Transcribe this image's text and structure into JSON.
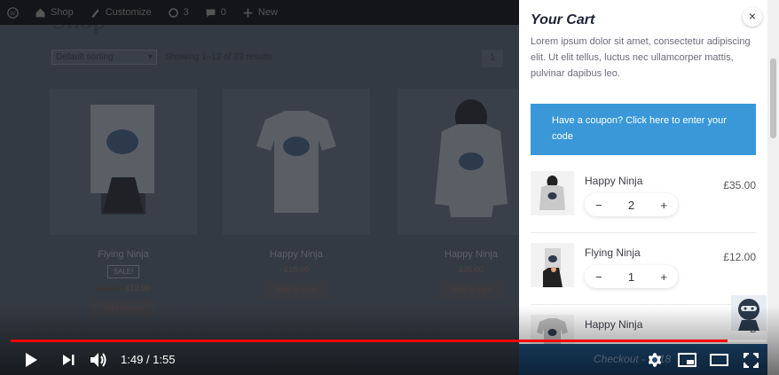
{
  "admin_bar": {
    "items": [
      "Shop",
      "Customize",
      "3",
      "0",
      "New"
    ]
  },
  "shop": {
    "title": "Shop",
    "sort_value": "Default sorting",
    "result_count": "Showing 1–12 of 23 results",
    "page_control": "1",
    "products": [
      {
        "name": "Flying Ninja",
        "badge": "SALE!",
        "old_price": "£15.00",
        "price": "£12.00",
        "button": "Add to cart"
      },
      {
        "name": "Happy Ninja",
        "price": "£18.00",
        "button": "Add to cart"
      },
      {
        "name": "Happy Ninja",
        "price": "£35.00",
        "button": "Add to cart"
      }
    ]
  },
  "cart": {
    "title": "Your Cart",
    "close_icon": "×",
    "description": "Lorem ipsum dolor sit amet, consectetur adipiscing elit. Ut elit tellus, luctus nec ullamcorper mattis, pulvinar dapibus leo.",
    "coupon_text": "Have a coupon? Click here to enter your code",
    "items": [
      {
        "name": "Happy Ninja",
        "price": "£35.00",
        "qty": "2",
        "minus": "−",
        "plus": "+"
      },
      {
        "name": "Flying Ninja",
        "price": "£12.00",
        "qty": "1",
        "minus": "−",
        "plus": "+"
      },
      {
        "name": "Happy Ninja",
        "price": "£",
        "qty": "",
        "minus": "",
        "plus": ""
      }
    ],
    "checkout_label": "Checkout - £118"
  },
  "player": {
    "time": "1:49 / 1:55",
    "progress": 0.948,
    "accent": "#ff0000",
    "icons": [
      "play-icon",
      "next-icon",
      "volume-icon",
      "settings-icon",
      "miniplayer-icon",
      "theater-icon",
      "fullscreen-icon"
    ]
  }
}
